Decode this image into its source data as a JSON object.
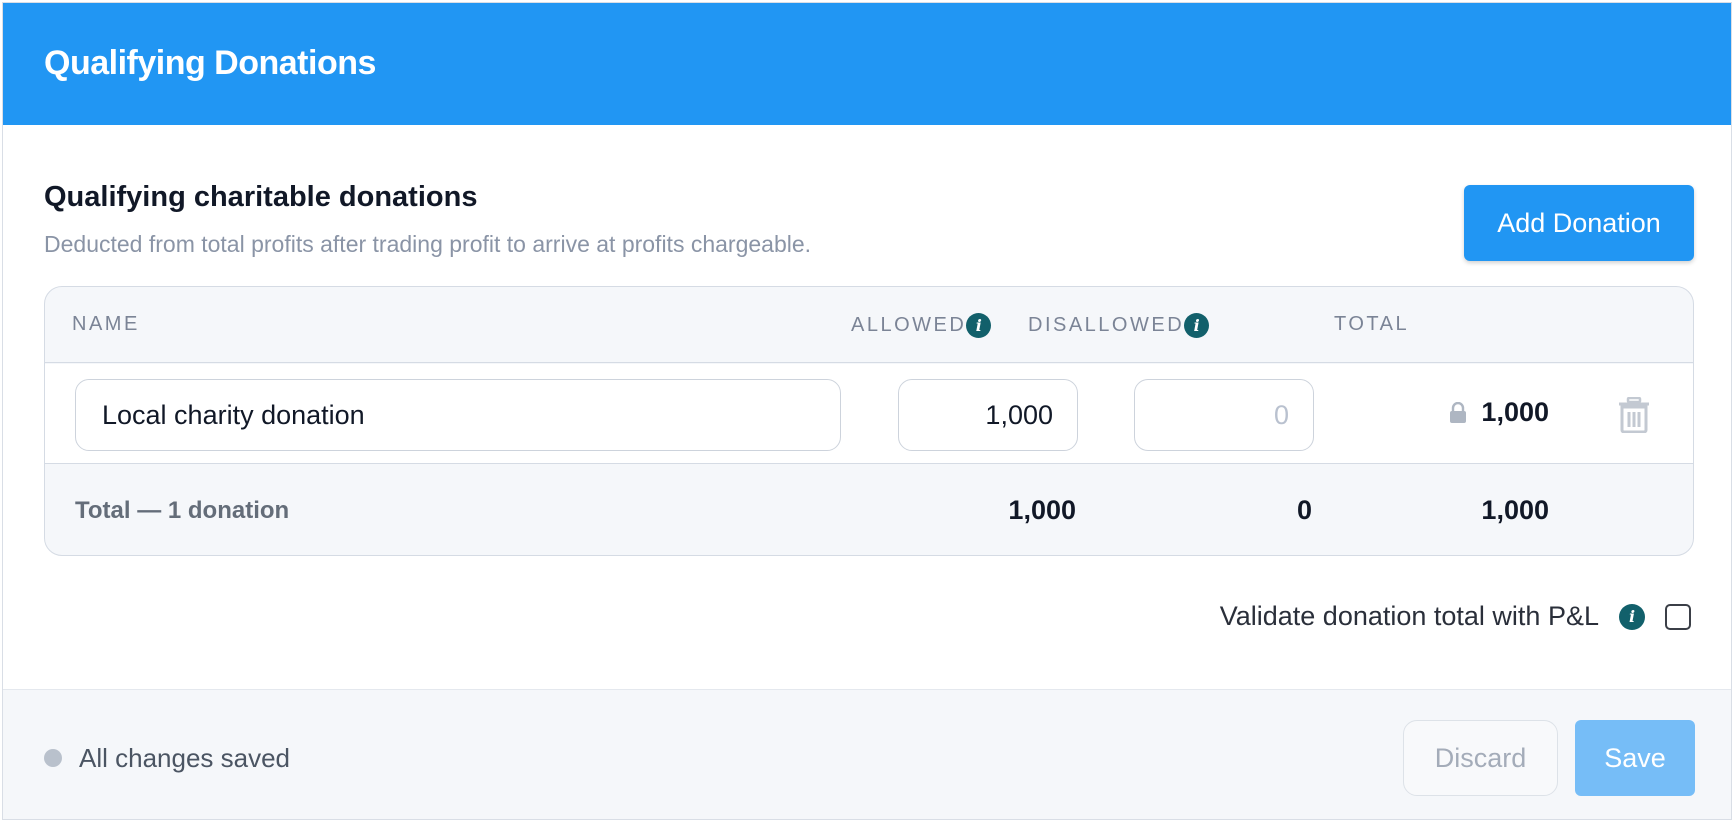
{
  "header": {
    "title": "Qualifying Donations"
  },
  "section": {
    "title": "Qualifying charitable donations",
    "subtitle": "Deducted from total profits after trading profit to arrive at profits chargeable.",
    "add_button_label": "Add Donation"
  },
  "table": {
    "columns": {
      "name": "NAME",
      "allowed": "ALLOWED",
      "disallowed": "DISALLOWED",
      "total": "TOTAL"
    },
    "rows": [
      {
        "name": "Local charity donation",
        "allowed": "1,000",
        "disallowed_placeholder": "0",
        "total": "1,000"
      }
    ],
    "footer": {
      "label": "Total — 1 donation",
      "allowed": "1,000",
      "disallowed": "0",
      "total": "1,000"
    }
  },
  "validate": {
    "label": "Validate donation total with P&L",
    "checked": false
  },
  "footer": {
    "status": "All changes saved",
    "discard_label": "Discard",
    "save_label": "Save"
  },
  "colors": {
    "header_bg": "#2196f3",
    "primary_button": "#2196f3",
    "save_button_disabled": "#76bdf7",
    "info_icon": "#12606b"
  },
  "icons": [
    "info-icon",
    "lock-icon",
    "trash-icon",
    "status-dot"
  ]
}
